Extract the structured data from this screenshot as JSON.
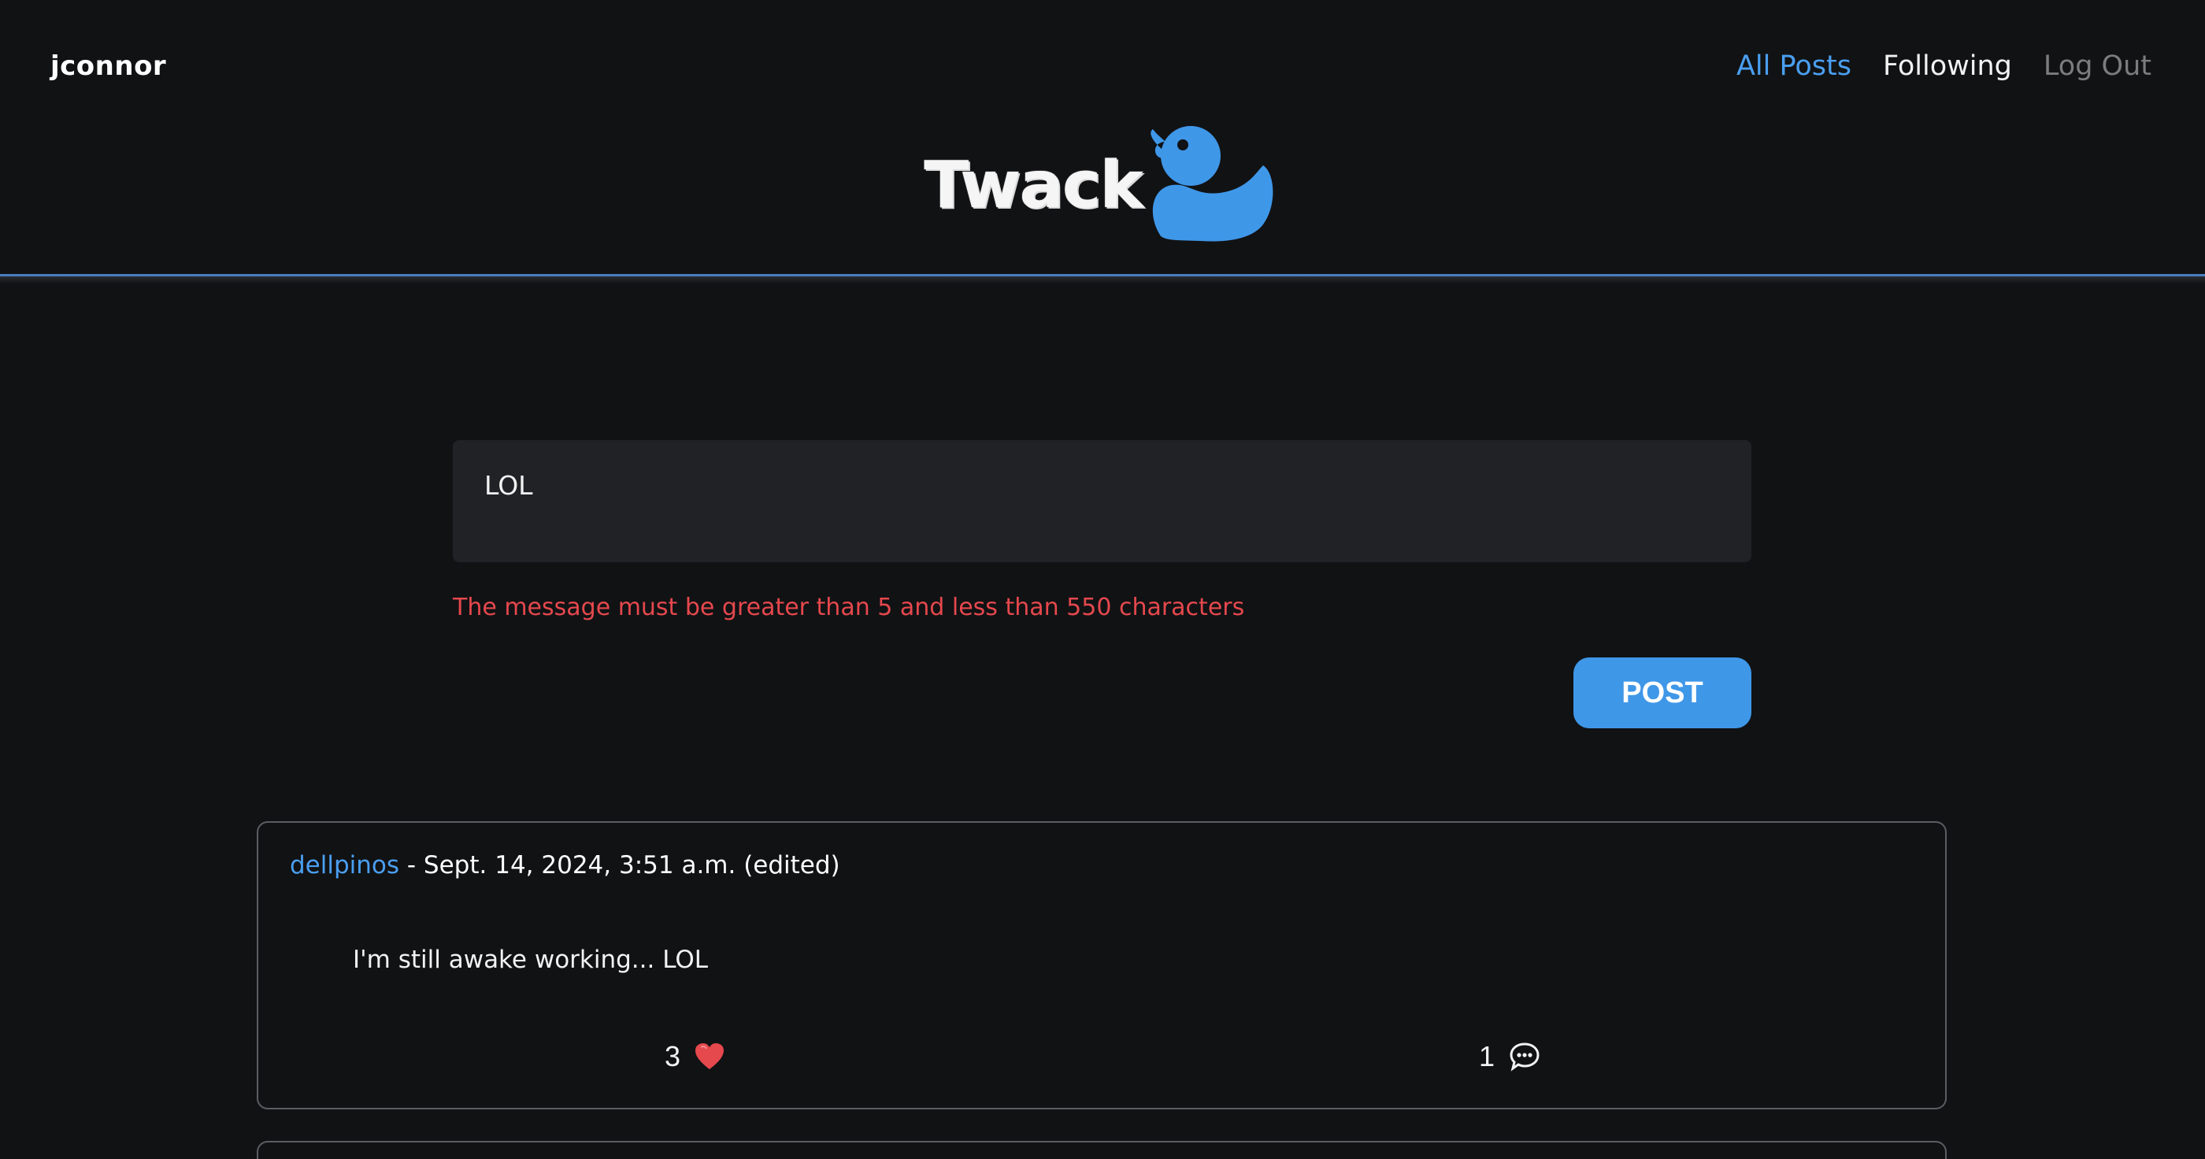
{
  "header": {
    "username": "jconnor",
    "nav": {
      "all_posts": "All Posts",
      "following": "Following",
      "log_out": "Log Out"
    },
    "logo_text": "Twack"
  },
  "composer": {
    "message_value": "LOL",
    "error": "The message must be greater than 5 and less than 550 characters",
    "post_label": "POST"
  },
  "posts": [
    {
      "author": "dellpinos",
      "meta": "- Sept. 14, 2024, 3:51 a.m. (edited)",
      "body": "I'm still awake working... LOL",
      "likes": "3",
      "comments": "1"
    }
  ],
  "colors": {
    "accent": "#4a9ff0",
    "error": "#e5484d",
    "like_heart": "#e5484d",
    "background": "#111214"
  },
  "icons": {
    "like": "heart-icon",
    "comment": "speech-bubble-icon",
    "logo": "duck-icon"
  }
}
